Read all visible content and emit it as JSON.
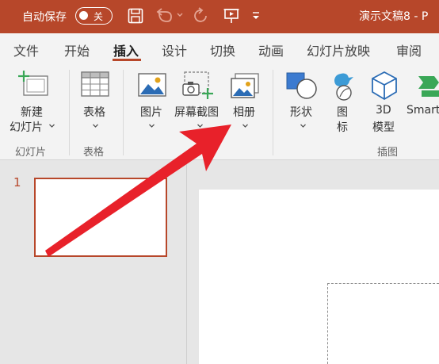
{
  "titlebar": {
    "autosave_label": "自动保存",
    "autosave_state": "关",
    "doc_title": "演示文稿8 - P",
    "colors": {
      "bar": "#b7472a",
      "text": "#ffffff"
    },
    "icons": [
      "save-icon",
      "undo-icon",
      "redo-icon",
      "present-icon",
      "customize-qat-icon"
    ]
  },
  "tabs": [
    "文件",
    "开始",
    "插入",
    "设计",
    "切换",
    "动画",
    "幻灯片放映",
    "审阅"
  ],
  "active_tab": "插入",
  "ribbon": {
    "new_slide": {
      "line1": "新建",
      "line2": "幻灯片"
    },
    "table": {
      "label": "表格"
    },
    "images": {
      "label": "图片"
    },
    "screenshot": {
      "label": "屏幕截图"
    },
    "album": {
      "label": "相册"
    },
    "shapes": {
      "label": "形状"
    },
    "icons": {
      "line1": "图",
      "line2": "标"
    },
    "models3d": {
      "line1": "3D",
      "line2": "模型"
    },
    "smartart": {
      "label": "Smart"
    },
    "groups": {
      "slides": "幻灯片",
      "tables": "表格",
      "illustrations": "插图"
    }
  },
  "slides_pane": {
    "slide_number": "1"
  },
  "accent": "#b7472a",
  "annotation": {
    "arrow_color": "#e8212a"
  }
}
